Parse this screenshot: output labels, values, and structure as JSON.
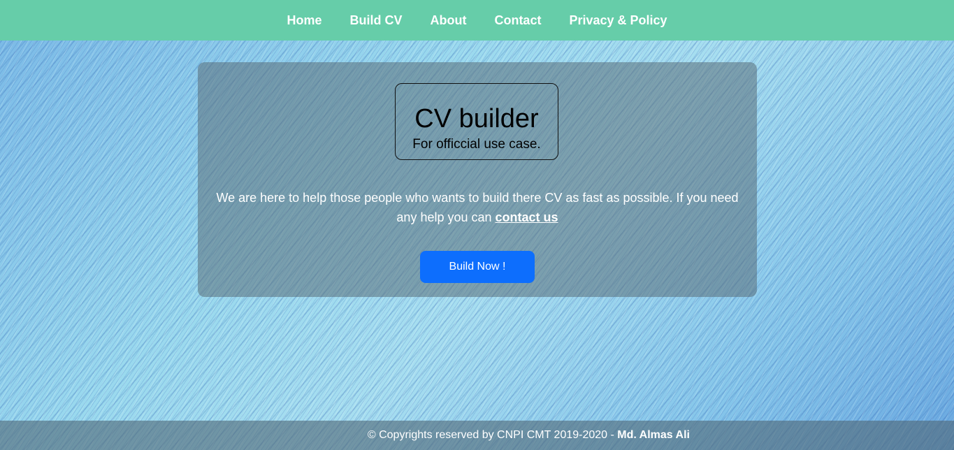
{
  "nav": {
    "items": [
      {
        "label": "Home"
      },
      {
        "label": "Build CV"
      },
      {
        "label": "About"
      },
      {
        "label": "Contact"
      },
      {
        "label": "Privacy & Policy"
      }
    ]
  },
  "hero": {
    "title": "CV builder",
    "subtitle": "For officcial use case.",
    "intro_text": "We are here to help those people who wants to build there CV as fast as possible. If you need any help you can ",
    "contact_link": "contact us",
    "button_label": "Build Now !"
  },
  "footer": {
    "copyright": "© Copyrights reserved by CNPI CMT 2019-2020 - ",
    "author": "Md. Almas Ali"
  },
  "colors": {
    "navbar_bg": "#66cda9",
    "button_bg": "#0d6efd",
    "text_light": "#ffffff"
  }
}
